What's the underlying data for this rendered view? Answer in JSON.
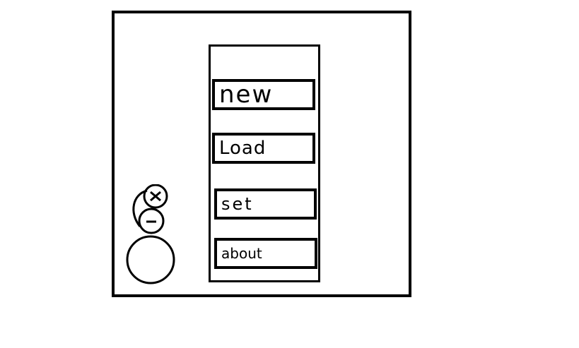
{
  "menu": {
    "items": [
      {
        "label": "new"
      },
      {
        "label": "Load"
      },
      {
        "label": "set"
      },
      {
        "label": "about"
      }
    ]
  },
  "mascot": {
    "icon": "snowman-icon"
  }
}
